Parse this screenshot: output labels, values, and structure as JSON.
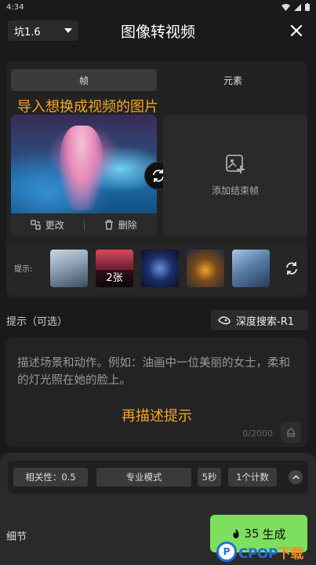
{
  "status_bar": {
    "time": "4:34"
  },
  "header": {
    "model_select_value": "坑1.6",
    "title": "图像转视频"
  },
  "tabs": [
    {
      "label": "帧",
      "active": true
    },
    {
      "label": "元素",
      "active": false
    }
  ],
  "annotations": {
    "import_caption": "导入想换成视频的图片",
    "prompt_caption": "再描述提示"
  },
  "start_frame": {
    "change_label": "更改",
    "delete_label": "删除"
  },
  "end_frame": {
    "add_label": "添加结束帧"
  },
  "hints": {
    "label": "提示:",
    "thumbnails": [
      {
        "badge": ""
      },
      {
        "badge": "2张"
      },
      {
        "badge": ""
      },
      {
        "badge": ""
      },
      {
        "badge": ""
      }
    ]
  },
  "prompt": {
    "label": "提示（可选）",
    "deep_search_label": "深度搜索-R1",
    "placeholder": "描述场景和动作。例如：油画中一位美丽的女士，柔和的灯光照在她的脸上。",
    "char_count": "0/2000"
  },
  "settings": {
    "relevance": "相关性：0.5",
    "mode": "专业模式",
    "duration": "5秒",
    "count": "1个计数",
    "detail_label": "细节"
  },
  "generate": {
    "cost": "35",
    "label": "生成"
  },
  "watermark": {
    "prefix": "P",
    "mid": "CPOP",
    "suffix": "下载"
  },
  "colors": {
    "background": "#1a1a1a",
    "accent_caption": "#f5a623",
    "generate": "#7ddf5e"
  }
}
